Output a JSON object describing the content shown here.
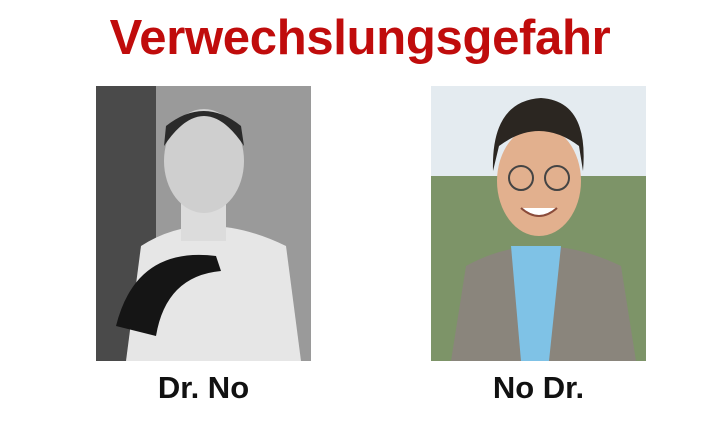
{
  "title": "Verwechslungsgefahr",
  "left": {
    "caption": "Dr. No",
    "photo": "black-and-white portrait of man in white high-collar jacket with black gloves"
  },
  "right": {
    "caption": "No Dr.",
    "photo": "color portrait of smiling man with glasses, grey jacket, blue shirt"
  },
  "colors": {
    "title": "#c00c0c",
    "caption": "#111111"
  }
}
